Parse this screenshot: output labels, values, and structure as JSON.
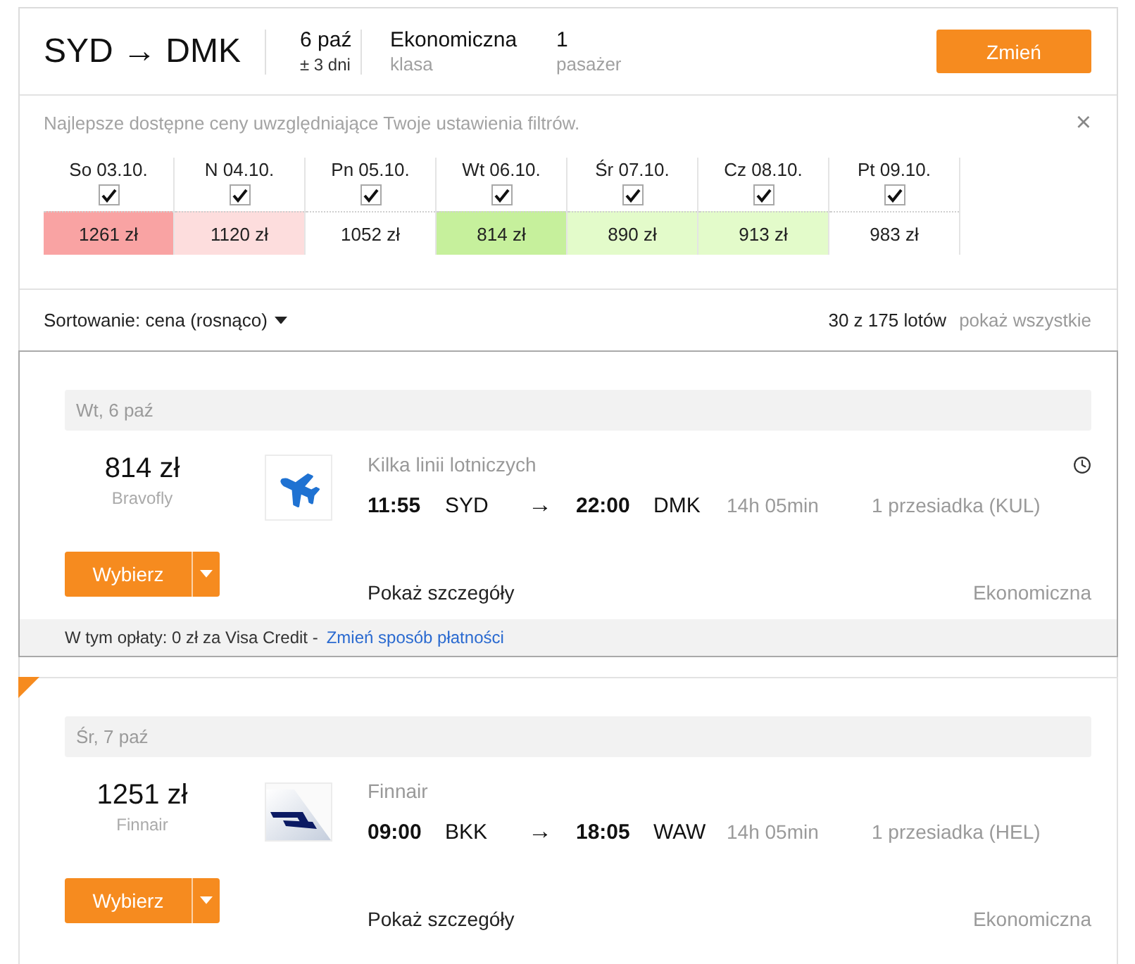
{
  "header": {
    "route": "SYD → DMK",
    "date": "6 paź",
    "date_range": "± 3 dni",
    "cabin": "Ekonomiczna",
    "cabin_label": "klasa",
    "passengers": "1",
    "passengers_label": "pasażer",
    "button": "Zmień"
  },
  "price_calendar": {
    "note": "Najlepsze dostępne ceny uwzględniające Twoje ustawienia filtrów.",
    "close": "×",
    "days": [
      {
        "label": "So 03.10.",
        "checked": true,
        "price": "1261 zł",
        "color": "#f9a3a3"
      },
      {
        "label": "N 04.10.",
        "checked": true,
        "price": "1120 zł",
        "color": "#fddddd"
      },
      {
        "label": "Pn 05.10.",
        "checked": true,
        "price": "1052 zł",
        "color": "#ffffff"
      },
      {
        "label": "Wt 06.10.",
        "checked": true,
        "price": "814 zł",
        "color": "#c6f09c"
      },
      {
        "label": "Śr 07.10.",
        "checked": true,
        "price": "890 zł",
        "color": "#e3fbca"
      },
      {
        "label": "Cz 08.10.",
        "checked": true,
        "price": "913 zł",
        "color": "#e3fbca"
      },
      {
        "label": "Pt 09.10.",
        "checked": true,
        "price": "983 zł",
        "color": "#ffffff"
      }
    ]
  },
  "sort": {
    "label": "Sortowanie: cena (rosnąco)",
    "count": "30 z 175 lotów",
    "show_all": "pokaż wszystkie"
  },
  "flights": [
    {
      "highlighted": true,
      "corner_mark": false,
      "date": "Wt, 6 paź",
      "price": "814 zł",
      "seller": "Bravofly",
      "logo": {
        "kind": "plane"
      },
      "airline": "Kilka linii lotniczych",
      "clock": true,
      "departure_time": "11:55",
      "origin": "SYD",
      "arrow": "→",
      "arrival_time": "22:00",
      "destination": "DMK",
      "duration": "14h 05min",
      "stops": "1 przesiadka (KUL)",
      "button": "Wybierz",
      "details": "Pokaż szczegóły",
      "cabin": "Ekonomiczna",
      "fees": {
        "text": "W tym opłaty: 0 zł za Visa Credit -",
        "link": "Zmień sposób płatności"
      }
    },
    {
      "highlighted": false,
      "corner_mark": true,
      "date": "Śr, 7 paź",
      "price": "1251 zł",
      "seller": "Finnair",
      "logo": {
        "kind": "tail"
      },
      "airline": "Finnair",
      "clock": false,
      "departure_time": "09:00",
      "origin": "BKK",
      "arrow": "→",
      "arrival_time": "18:05",
      "destination": "WAW",
      "duration": "14h 05min",
      "stops": "1 przesiadka (HEL)",
      "button": "Wybierz",
      "details": "Pokaż szczegóły",
      "cabin": "Ekonomiczna"
    }
  ]
}
